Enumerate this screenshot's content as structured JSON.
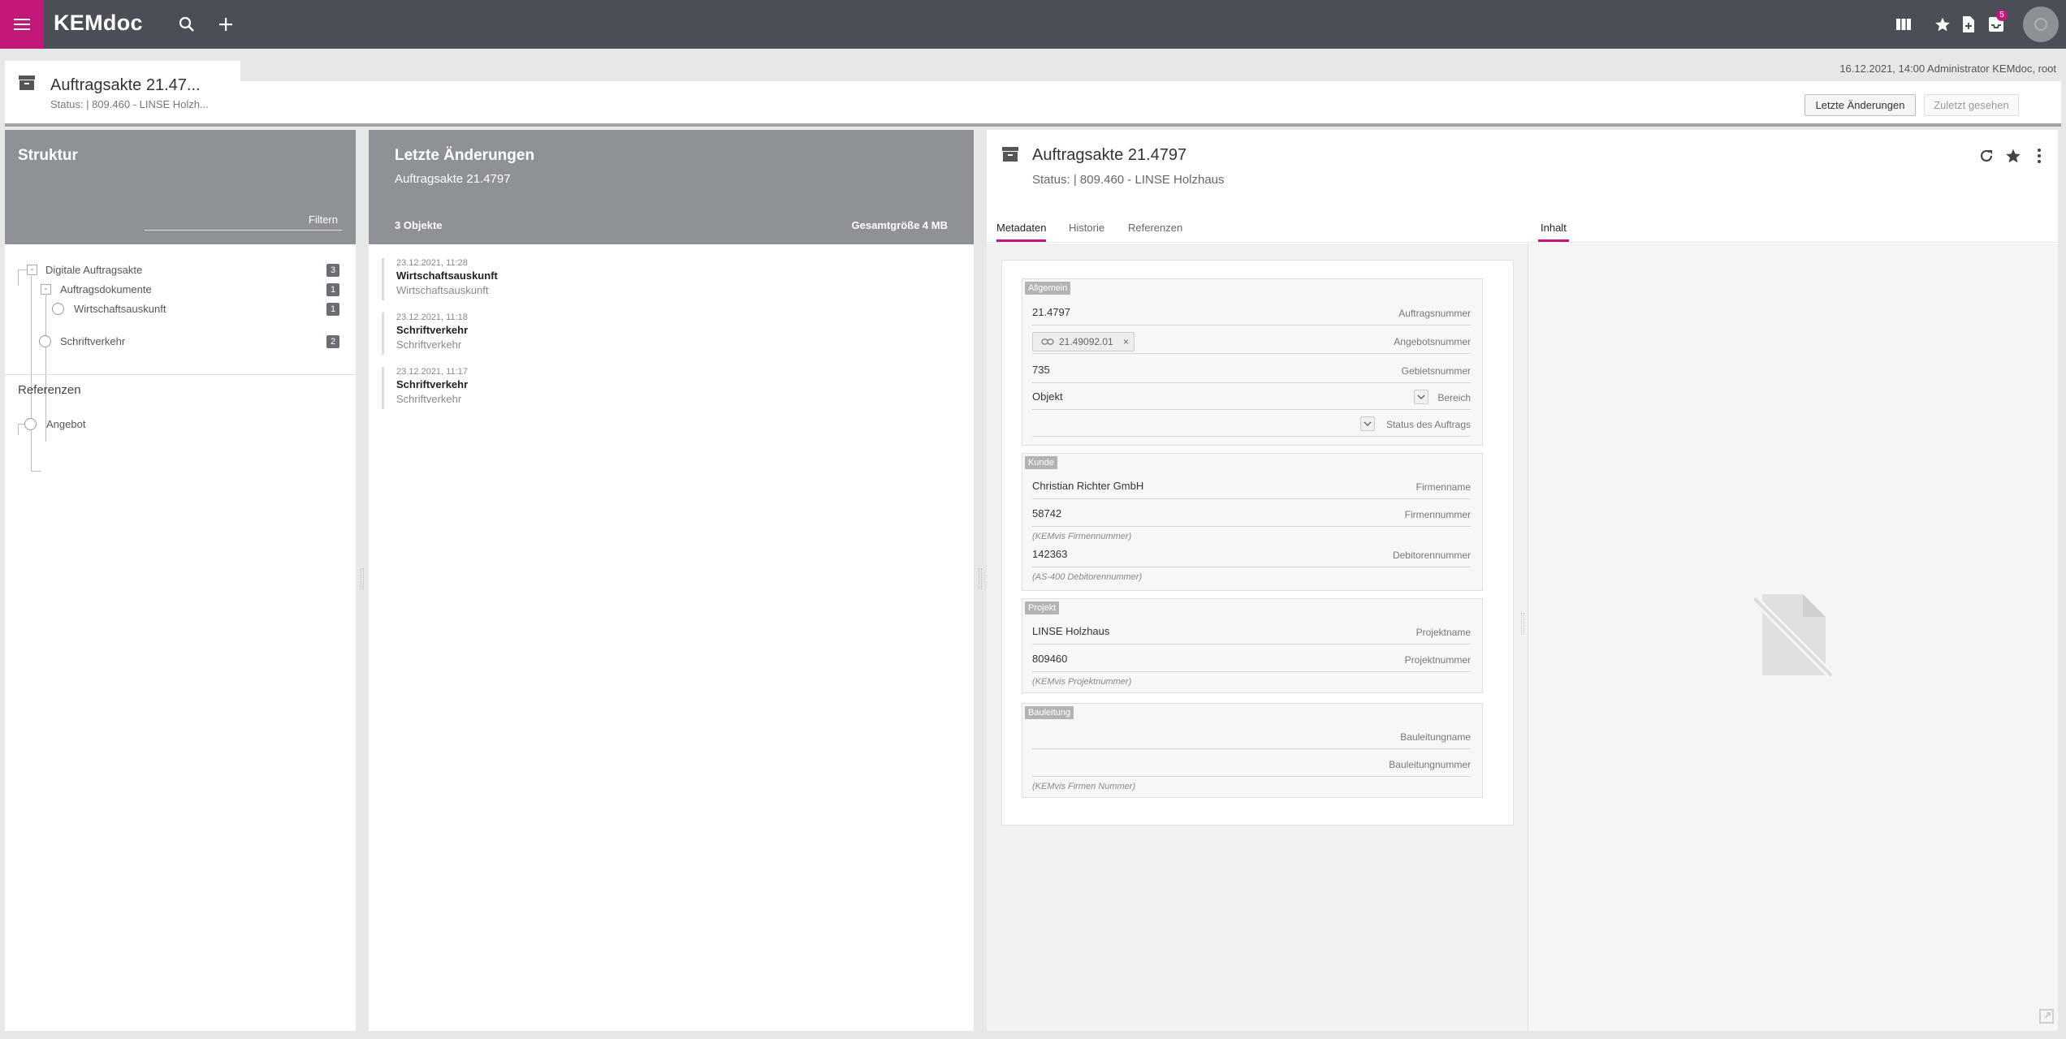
{
  "app": {
    "brand": "KEMdoc",
    "accent": "#c2187a",
    "notification_count": "5",
    "icons": [
      "menu-icon",
      "search-icon",
      "plus-icon",
      "columns-icon",
      "star-icon",
      "document-add-icon",
      "inbox-icon",
      "avatar-icon"
    ]
  },
  "header": {
    "title": "Auftragsakte 21.47...",
    "status": "Status: | 809.460 - LINSE Holzh...",
    "user_line": "16.12.2021, 14:00  Administrator KEMdoc, root",
    "btn_recent": "Letzte Änderungen",
    "btn_seen": "Zuletzt gesehen"
  },
  "structure": {
    "title": "Struktur",
    "filter_label": "Filtern",
    "tree": [
      {
        "label": "Digitale Auftragsakte",
        "count": "3"
      },
      {
        "label": "Auftragsdokumente",
        "count": "1"
      },
      {
        "label": "Wirtschaftsauskunft",
        "count": "1"
      },
      {
        "label": "Schriftverkehr",
        "count": "2"
      }
    ],
    "references_title": "Referenzen",
    "references": [
      {
        "label": "Angebot"
      }
    ]
  },
  "recent": {
    "title": "Letzte Änderungen",
    "subtitle": "Auftragsakte 21.4797",
    "count": "3 Objekte",
    "size": "Gesamtgröße 4 MB",
    "items": [
      {
        "date": "23.12.2021, 11:28",
        "name": "Wirtschaftsauskunft",
        "type": "Wirtschaftsauskunft"
      },
      {
        "date": "23.12.2021, 11:18",
        "name": "Schriftverkehr",
        "type": "Schriftverkehr"
      },
      {
        "date": "23.12.2021, 11:17",
        "name": "Schriftverkehr",
        "type": "Schriftverkehr"
      }
    ]
  },
  "detail": {
    "title": "Auftragsakte 21.4797",
    "status": "Status: | 809.460 - LINSE Holzhaus",
    "tabs": [
      "Metadaten",
      "Historie",
      "Referenzen"
    ],
    "content_tab": "Inhalt",
    "groups": {
      "allgemein": {
        "label": "Allgemein",
        "auftragsnummer": {
          "value": "21.4797",
          "label": "Auftragsnummer"
        },
        "angebotsnummer": {
          "chip": "21.49092.01",
          "label": "Angebotsnummer"
        },
        "gebietsnummer": {
          "value": "735",
          "label": "Gebietsnummer"
        },
        "bereich": {
          "value": "Objekt",
          "label": "Bereich"
        },
        "status_auftrag": {
          "value": "",
          "label": "Status des Auftrags"
        }
      },
      "kunde": {
        "label": "Kunde",
        "firmenname": {
          "value": "Christian Richter GmbH",
          "label": "Firmenname"
        },
        "firmennummer": {
          "value": "58742",
          "label": "Firmennummer",
          "hint": "(KEMvis Firmennummer)"
        },
        "debitorennummer": {
          "value": "142363",
          "label": "Debitorennummer",
          "hint": "(AS-400 Debitorennummer)"
        }
      },
      "projekt": {
        "label": "Projekt",
        "projektname": {
          "value": "LINSE Holzhaus",
          "label": "Projektname"
        },
        "projektnummer": {
          "value": "809460",
          "label": "Projektnummer",
          "hint": "(KEMvis Projektnummer)"
        }
      },
      "bauleitung": {
        "label": "Bauleitung",
        "bauleitungname": {
          "value": "",
          "label": "Bauleitungname"
        },
        "bauleitungnummer": {
          "value": "",
          "label": "Bauleitungnummer",
          "hint": "(KEMvis Firmen Nummer)"
        }
      }
    }
  }
}
